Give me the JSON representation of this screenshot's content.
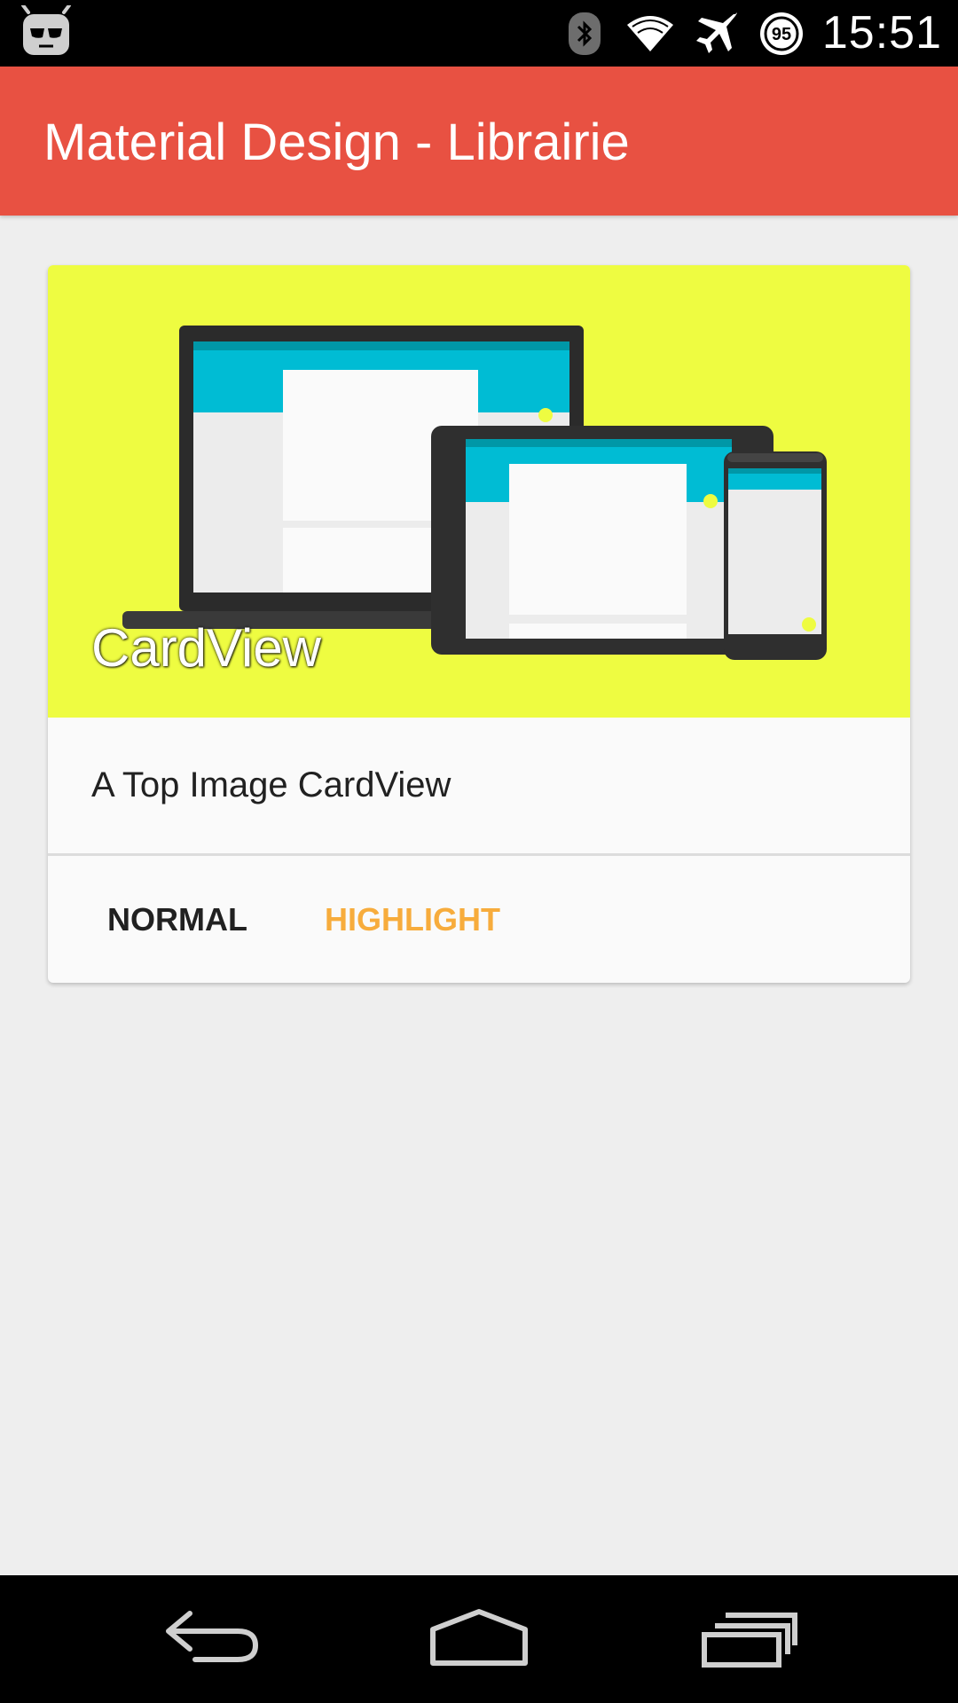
{
  "status_bar": {
    "time": "15:51",
    "battery_level": "95",
    "icons": [
      "cyanogenmod-android-icon",
      "bluetooth-icon",
      "wifi-icon",
      "airplane-mode-icon",
      "battery-icon"
    ]
  },
  "toolbar": {
    "title": "Material Design - Librairie",
    "color": "#e85142"
  },
  "card": {
    "media_title": "CardView",
    "media_background": "#eefc41",
    "text": "A Top Image CardView",
    "actions": {
      "normal_label": "NORMAL",
      "highlight_label": "HIGHLIGHT",
      "highlight_color": "#f7ac3c"
    }
  },
  "nav_bar": {
    "buttons": [
      "back-icon",
      "home-icon",
      "recents-icon"
    ]
  }
}
